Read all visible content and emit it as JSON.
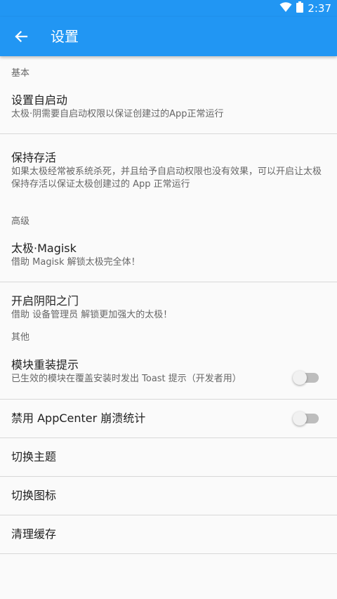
{
  "status_bar": {
    "time": "2:37",
    "wifi_icon": "wifi-icon",
    "battery_icon": "battery-icon"
  },
  "app_bar": {
    "title": "设置",
    "back_icon": "arrow-back-icon",
    "color": "#2196f3"
  },
  "sections": {
    "basic": {
      "header": "基本",
      "auto_start": {
        "title": "设置自启动",
        "summary": "太极·阴需要自启动权限以保证创建过的App正常运行"
      },
      "keep_alive": {
        "title": "保持存活",
        "summary": "如果太极经常被系统杀死，并且给予自启动权限也没有效果，可以开启让太极保持存活以保证太极创建过的 App 正常运行"
      }
    },
    "advanced": {
      "header": "高级",
      "magisk": {
        "title": "太极·Magisk",
        "summary": "借助 Magisk 解锁太极完全体！"
      },
      "yinyang_gate": {
        "title": "开启阴阳之门",
        "summary": "借助 设备管理员 解锁更加强大的太极！"
      }
    },
    "other": {
      "header": "其他",
      "module_reinstall": {
        "title": "模块重装提示",
        "summary": "已生效的模块在覆盖安装时发出 Toast 提示（开发者用）",
        "enabled": false
      },
      "disable_appcenter": {
        "title": "禁用 AppCenter 崩溃统计",
        "enabled": false
      },
      "switch_theme": {
        "title": "切换主题"
      },
      "switch_icon": {
        "title": "切换图标"
      },
      "clear_cache": {
        "title": "清理缓存"
      }
    }
  }
}
